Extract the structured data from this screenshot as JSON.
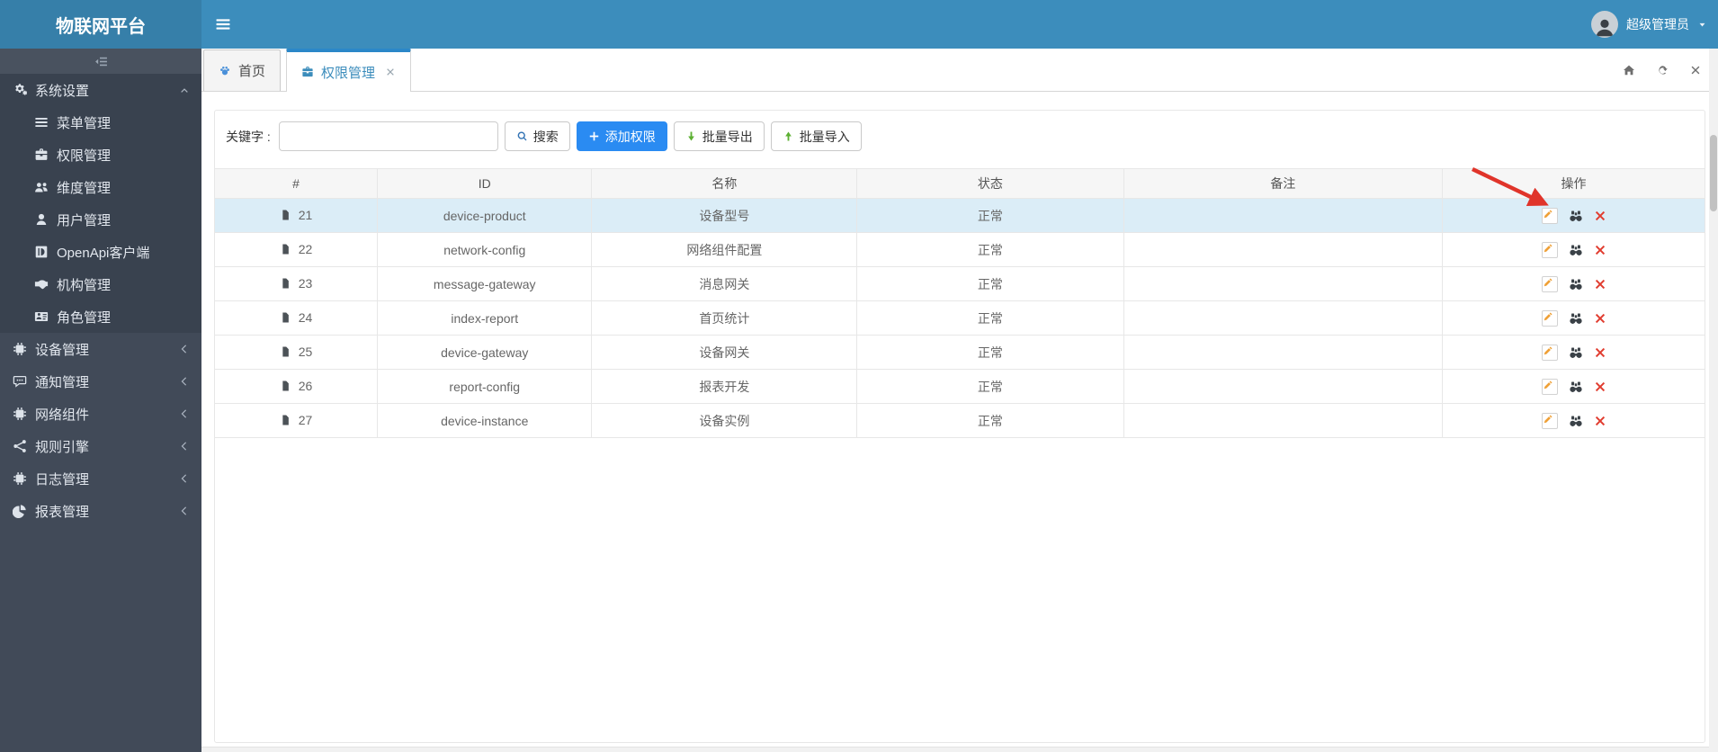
{
  "navbar": {
    "brand": "物联网平台",
    "user_name": "超级管理员"
  },
  "sidebar": {
    "items": [
      {
        "key": "system-settings",
        "label": "系统设置",
        "icon": "cogs-icon",
        "level": 1,
        "chevron": "chevron-up-icon",
        "active": true,
        "open_group": true
      },
      {
        "key": "menu-management",
        "label": "菜单管理",
        "icon": "bars-icon",
        "level": 2,
        "open_group": true
      },
      {
        "key": "permission-management",
        "label": "权限管理",
        "icon": "briefcase-icon",
        "level": 2,
        "open_group": true
      },
      {
        "key": "dimension-management",
        "label": "维度管理",
        "icon": "users-icon",
        "level": 2,
        "open_group": true
      },
      {
        "key": "user-management",
        "label": "用户管理",
        "icon": "user-icon",
        "level": 2,
        "open_group": true
      },
      {
        "key": "openapi-client",
        "label": "OpenApi客户端",
        "icon": "api-client-icon",
        "level": 2,
        "open_group": true
      },
      {
        "key": "org-management",
        "label": "机构管理",
        "icon": "handshake-icon",
        "level": 2,
        "open_group": true
      },
      {
        "key": "role-management",
        "label": "角色管理",
        "icon": "id-card-icon",
        "level": 2,
        "open_group": true
      },
      {
        "key": "device-management",
        "label": "设备管理",
        "icon": "chip-icon",
        "level": 1,
        "chevron": "chevron-left-icon"
      },
      {
        "key": "notice-management",
        "label": "通知管理",
        "icon": "comment-icon",
        "level": 1,
        "chevron": "chevron-left-icon"
      },
      {
        "key": "network-components",
        "label": "网络组件",
        "icon": "chip-icon",
        "level": 1,
        "chevron": "chevron-left-icon"
      },
      {
        "key": "rule-engine",
        "label": "规则引擎",
        "icon": "share-icon",
        "level": 1,
        "chevron": "chevron-left-icon"
      },
      {
        "key": "log-management",
        "label": "日志管理",
        "icon": "chip-icon",
        "level": 1,
        "chevron": "chevron-left-icon"
      },
      {
        "key": "report-management",
        "label": "报表管理",
        "icon": "pie-chart-icon",
        "level": 1,
        "chevron": "chevron-left-icon"
      }
    ]
  },
  "tabs": {
    "items": [
      {
        "label": "首页",
        "icon": "paw-icon",
        "active": false,
        "closable": false
      },
      {
        "label": "权限管理",
        "icon": "briefcase-icon",
        "active": true,
        "closable": true
      }
    ],
    "corner_actions": [
      {
        "name": "home",
        "icon": "home-icon"
      },
      {
        "name": "refresh",
        "icon": "refresh-icon"
      },
      {
        "name": "close",
        "icon": "close-icon"
      }
    ]
  },
  "toolbar": {
    "keyword_label": "关键字 :",
    "keyword_value": "",
    "search_label": "搜索",
    "add_label": "添加权限",
    "export_label": "批量导出",
    "import_label": "批量导入"
  },
  "table": {
    "columns": [
      "#",
      "ID",
      "名称",
      "状态",
      "备注",
      "操作"
    ],
    "row_icon": "file-icon",
    "row_actions": [
      {
        "name": "edit",
        "icon": "pencil-icon"
      },
      {
        "name": "view",
        "icon": "binoculars-icon"
      },
      {
        "name": "delete",
        "icon": "x-icon"
      }
    ],
    "rows": [
      {
        "num": "21",
        "id": "device-product",
        "name": "设备型号",
        "status": "正常",
        "remark": "",
        "highlighted": true
      },
      {
        "num": "22",
        "id": "network-config",
        "name": "网络组件配置",
        "status": "正常",
        "remark": "",
        "highlighted": false
      },
      {
        "num": "23",
        "id": "message-gateway",
        "name": "消息网关",
        "status": "正常",
        "remark": "",
        "highlighted": false
      },
      {
        "num": "24",
        "id": "index-report",
        "name": "首页统计",
        "status": "正常",
        "remark": "",
        "highlighted": false
      },
      {
        "num": "25",
        "id": "device-gateway",
        "name": "设备网关",
        "status": "正常",
        "remark": "",
        "highlighted": false
      },
      {
        "num": "26",
        "id": "report-config",
        "name": "报表开发",
        "status": "正常",
        "remark": "",
        "highlighted": false
      },
      {
        "num": "27",
        "id": "device-instance",
        "name": "设备实例",
        "status": "正常",
        "remark": "",
        "highlighted": false
      }
    ]
  },
  "annotation": {
    "arrow_color": "#e0342a",
    "points_at": "edit"
  },
  "colors": {
    "navbar": "#3c8dbc",
    "logo_bg": "#367fa9",
    "sidebar_bg": "#414a58",
    "sidebar_group_bg": "#39424f",
    "tab_active_top": "#2b87c8",
    "primary_button": "#2a8bf2",
    "row_highlight": "#dbedf7",
    "green_icon": "#5cb032",
    "edit_icon": "#efa036",
    "delete_icon": "#e13c2f"
  }
}
